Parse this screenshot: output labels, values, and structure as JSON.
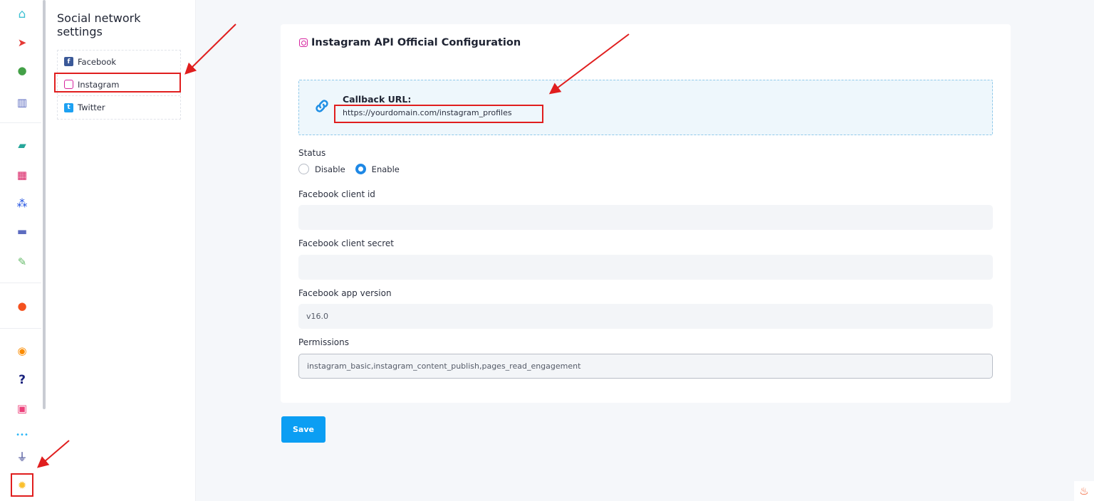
{
  "rail": {
    "icons": [
      {
        "name": "home-icon",
        "glyph": "⌂",
        "color": "#3ec1d3"
      },
      {
        "name": "send-icon",
        "glyph": "➤",
        "color": "#e53935"
      },
      {
        "name": "rocket-icon",
        "glyph": "●",
        "color": "#43a047"
      },
      {
        "name": "analytics-icon",
        "glyph": "▥",
        "color": "#5c6bc0"
      },
      {
        "name": "document-edit-icon",
        "glyph": "▰",
        "color": "#26a69a"
      },
      {
        "name": "calendar-icon",
        "glyph": "▦",
        "color": "#d81b60"
      },
      {
        "name": "share-icon",
        "glyph": "⁂",
        "color": "#1e4fe0"
      },
      {
        "name": "folder-icon",
        "glyph": "▬",
        "color": "#5c6bc0"
      },
      {
        "name": "magic-pen-icon",
        "glyph": "✎",
        "color": "#66bb6a"
      },
      {
        "name": "user-shield-icon",
        "glyph": "●",
        "color": "#f4511e"
      },
      {
        "name": "rss-icon",
        "glyph": "◉",
        "color": "#fb8c00"
      },
      {
        "name": "help-icon",
        "glyph": "?",
        "color": "#1a237e"
      },
      {
        "name": "id-card-icon",
        "glyph": "▣",
        "color": "#ec407a"
      },
      {
        "name": "dots-icon",
        "glyph": "•••",
        "color": "#29b6f6"
      },
      {
        "name": "plug-icon",
        "glyph": "⏚",
        "color": "#1a237e"
      },
      {
        "name": "settings-gear-icon",
        "glyph": "✹",
        "color": "#fbc02d"
      }
    ]
  },
  "side": {
    "title": "Social network settings",
    "items": [
      {
        "label": "Facebook",
        "icon": "facebook-icon"
      },
      {
        "label": "Instagram",
        "icon": "instagram-icon"
      },
      {
        "label": "Twitter",
        "icon": "twitter-icon"
      }
    ]
  },
  "main": {
    "title": "Instagram API Official Configuration",
    "callback": {
      "label": "Callback URL:",
      "url": "https://yourdomain.com/instagram_profiles"
    },
    "status": {
      "label": "Status",
      "options": [
        "Disable",
        "Enable"
      ],
      "selected": "Enable"
    },
    "fields": {
      "client_id": {
        "label": "Facebook client id",
        "value": ""
      },
      "client_secret": {
        "label": "Facebook client secret",
        "value": ""
      },
      "app_version": {
        "label": "Facebook app version",
        "value": "v16.0"
      },
      "permissions": {
        "label": "Permissions",
        "value": "instagram_basic,instagram_content_publish,pages_read_engagement"
      }
    },
    "save_label": "Save"
  },
  "colors": {
    "accent": "#0b9ef3",
    "annotation": "#e01e1e",
    "callback_bg": "#eef7fc"
  }
}
